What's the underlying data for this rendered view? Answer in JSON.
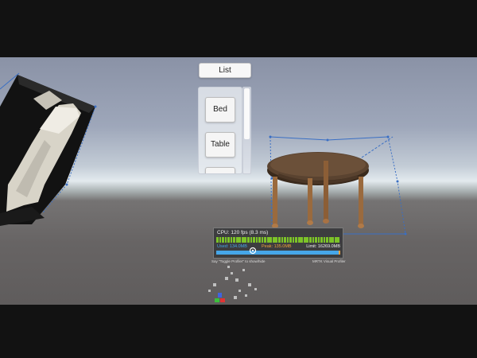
{
  "colors": {
    "sky": "#9ea7ba",
    "horizon": "#e3eaee",
    "ground": "#676464",
    "bounds_line": "#3a6fc4",
    "profiler_bg": "#3a3a3c",
    "frame_bar": "#7cc328",
    "memory_used": "#46a6e8",
    "memory_peak": "#f2a23c"
  },
  "menu": {
    "header_label": "List",
    "items": [
      {
        "label": "Bed"
      },
      {
        "label": "Table"
      },
      {
        "label": ""
      }
    ],
    "scroll_fraction": 0.6
  },
  "profiler": {
    "cpu_text": "CPU: 120 fps (8.3 ms)",
    "frame_bar_count": 44,
    "used_text": "Used: 134.0MB",
    "peak_text": "Peak: 135.0MB",
    "limit_text": "Limit: 16269.0MB",
    "used_mb": 134.0,
    "peak_mb": 135.0,
    "limit_mb": 16269.0,
    "hint_left": "Say \"Toggle Profiler\" to show/hide",
    "hint_right": "MRTK Visual Profiler"
  },
  "scene_objects": {
    "left": "couch-model",
    "right": "table-model",
    "gizmo": "axis-gizmo-icon",
    "cursor": "cursor-icon"
  }
}
